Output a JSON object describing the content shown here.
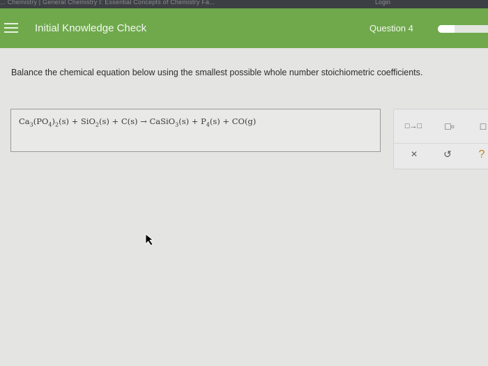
{
  "topbar": {
    "crumb": "... Chemistry | General Chemistry I: Essential Concepts of Chemistry Fa...",
    "login": "Login"
  },
  "header": {
    "title": "Initial Knowledge Check",
    "question_label": "Question 4",
    "progress_fraction": 0.3
  },
  "prompt": "Balance the chemical equation below using the smallest possible whole number stoichiometric coefficients.",
  "equation": {
    "reactants": [
      {
        "formula_parts": [
          "Ca",
          "3",
          "(PO",
          "4",
          ")",
          "2"
        ],
        "state": "(s)"
      },
      {
        "formula_parts": [
          "SiO",
          "2"
        ],
        "state": "(s)"
      },
      {
        "formula_parts": [
          "C"
        ],
        "state": "(s)"
      }
    ],
    "products": [
      {
        "formula_parts": [
          "CaSiO",
          "3"
        ],
        "state": "(s)"
      },
      {
        "formula_parts": [
          "P",
          "4"
        ],
        "state": "(s)"
      },
      {
        "formula_parts": [
          "CO"
        ],
        "state": "(g)"
      }
    ],
    "plus": "+",
    "arrow": "→"
  },
  "tools": {
    "icons": [
      "arrow-box-icon",
      "subscript-icon",
      "superscript-icon",
      "clear-icon",
      "undo-icon",
      "help-icon"
    ],
    "arrow_box": "□→□",
    "subscript": "□▫",
    "superscript": "□",
    "clear": "×",
    "undo": "↺",
    "help": "?"
  },
  "colors": {
    "header_green": "#6fa94c",
    "help_orange": "#c47d20"
  }
}
